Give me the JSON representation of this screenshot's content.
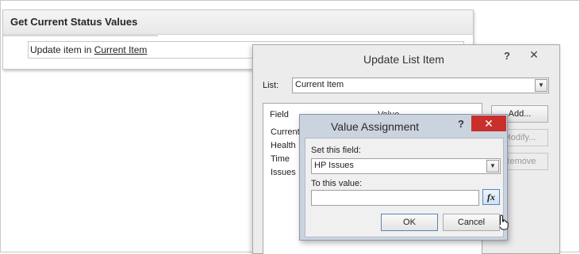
{
  "workflow_step": {
    "title": "Get Current Status Values",
    "action_prefix": "Update item in ",
    "action_link": "Current Item"
  },
  "update_list_item_dialog": {
    "title": "Update List Item",
    "help": "?",
    "close": "✕",
    "list_label": "List:",
    "list_value": "Current Item",
    "grid_headers": {
      "field": "Field",
      "value": "Value"
    },
    "grid_rows": [
      "Current",
      "Health",
      "Time",
      "Issues"
    ],
    "buttons": {
      "add": "Add...",
      "modify": "Modify...",
      "remove": "Remove"
    }
  },
  "value_assignment_dialog": {
    "title": "Value Assignment",
    "help": "?",
    "close": "✕",
    "set_field_label": "Set this field:",
    "field_value": "HP Issues",
    "to_value_label": "To this value:",
    "value_input": "",
    "fx_label": "fx",
    "ok_label": "OK",
    "cancel_label": "Cancel"
  },
  "icons": {
    "dropdown": "chevron-down-icon",
    "fx": "function-icon",
    "cursor": "pointer-cursor-icon"
  },
  "colors": {
    "close_active": "#c9302c",
    "dialog_frame": "#cbd3de"
  }
}
